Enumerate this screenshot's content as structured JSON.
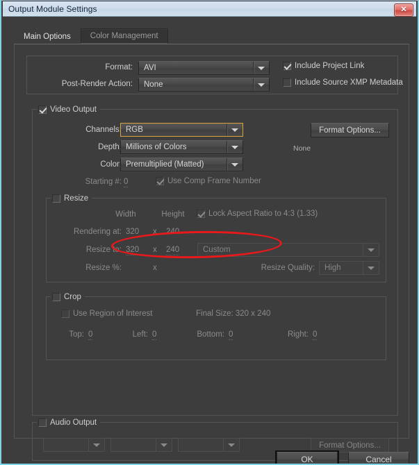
{
  "window": {
    "title": "Output Module Settings",
    "close_label": "✕"
  },
  "tabs": [
    {
      "label": "Main Options",
      "active": true
    },
    {
      "label": "Color Management",
      "active": false
    }
  ],
  "top_section": {
    "format_label": "Format:",
    "format_value": "AVI",
    "post_render_label": "Post-Render Action:",
    "post_render_value": "None",
    "include_project_link_label": "Include Project Link",
    "include_project_link_checked": true,
    "include_xmp_label": "Include Source XMP Metadata",
    "include_xmp_checked": false
  },
  "video_output": {
    "group_label": "Video Output",
    "group_checked": true,
    "channels_label": "Channels:",
    "channels_value": "RGB",
    "depth_label": "Depth:",
    "depth_value": "Millions of Colors",
    "color_label": "Color:",
    "color_value": "Premultiplied (Matted)",
    "starting_num_label": "Starting #:",
    "starting_num_value": "0",
    "use_comp_frame_label": "Use Comp Frame Number",
    "use_comp_frame_checked": true,
    "format_options_label": "Format Options...",
    "format_options_status": "None"
  },
  "resize": {
    "group_label": "Resize",
    "group_checked": false,
    "width_header": "Width",
    "height_header": "Height",
    "lock_aspect_label": "Lock Aspect Ratio to 4:3 (1.33)",
    "lock_aspect_checked": true,
    "rendering_at_label": "Rendering at:",
    "rendering_width": "320",
    "rendering_height": "240",
    "resize_to_label": "Resize to:",
    "resize_width": "320",
    "resize_height": "240",
    "preset_value": "Custom",
    "resize_pct_label": "Resize %:",
    "times_symbol": "x",
    "resize_quality_label": "Resize Quality:",
    "resize_quality_value": "High"
  },
  "crop": {
    "group_label": "Crop",
    "group_checked": false,
    "use_roi_label": "Use Region of Interest",
    "use_roi_checked": false,
    "final_size_label": "Final Size: 320 x 240",
    "top_label": "Top:",
    "top_value": "0",
    "left_label": "Left:",
    "left_value": "0",
    "bottom_label": "Bottom:",
    "bottom_value": "0",
    "right_label": "Right:",
    "right_value": "0"
  },
  "audio_output": {
    "group_label": "Audio Output",
    "group_checked": false,
    "rate_value": "",
    "depth_value": "",
    "channels_value": "",
    "format_options_label": "Format Options..."
  },
  "footer": {
    "ok_label": "OK",
    "cancel_label": "Cancel"
  },
  "annotation": {
    "shape": "red-ellipse",
    "target": "channels-dropdown",
    "color": "#e8191b"
  }
}
